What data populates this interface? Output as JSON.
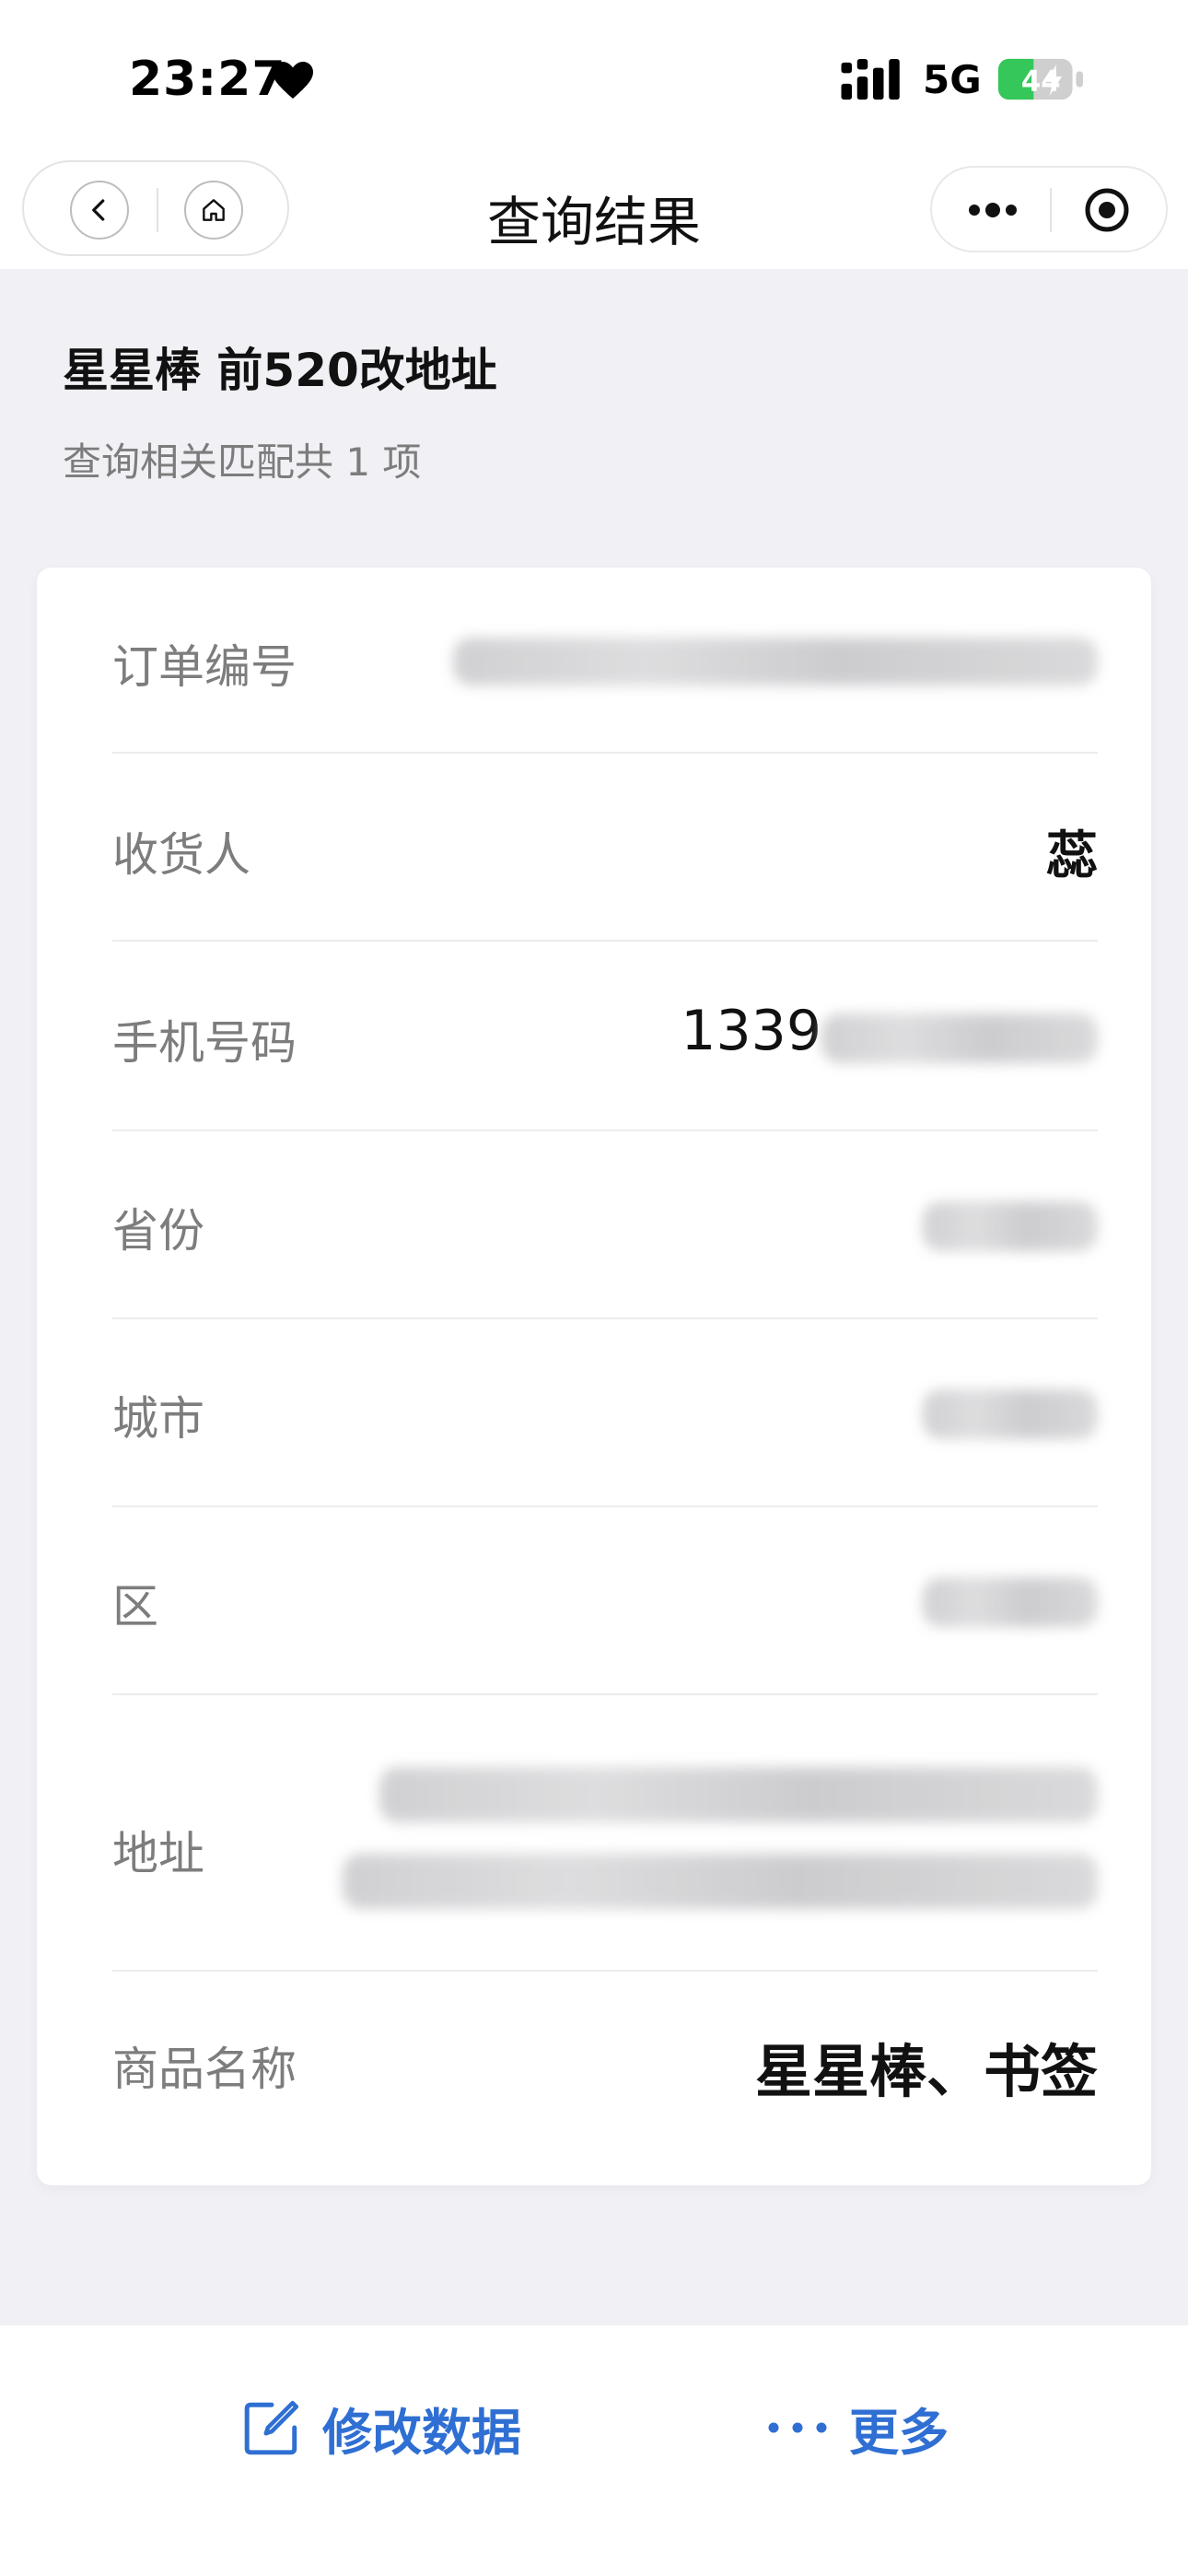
{
  "status_bar": {
    "time": "23:27",
    "network": "5G",
    "battery": "44",
    "icons": [
      "heart-icon",
      "signal-icon",
      "battery-charging-icon"
    ]
  },
  "nav": {
    "title": "查询结果",
    "icons": [
      "back-icon",
      "home-icon",
      "more-dots-icon",
      "target-icon"
    ]
  },
  "header": {
    "title": "星星棒 前520改地址",
    "subtitle": "查询相关匹配共 1 项"
  },
  "record": {
    "rows": [
      {
        "label": "订单编号",
        "value": ""
      },
      {
        "label": "收货人",
        "value": "蕊"
      },
      {
        "label": "手机号码",
        "value": "1339"
      },
      {
        "label": "省份",
        "value": ""
      },
      {
        "label": "城市",
        "value": ""
      },
      {
        "label": "区",
        "value": ""
      },
      {
        "label": "地址",
        "value": ""
      },
      {
        "label": "商品名称",
        "value": "星星棒、书签"
      }
    ]
  },
  "bottom_bar": {
    "edit_label": "修改数据",
    "more_label": "更多",
    "accent_color": "#2f6fd3",
    "icons": [
      "edit-icon",
      "more-dots-icon"
    ]
  }
}
